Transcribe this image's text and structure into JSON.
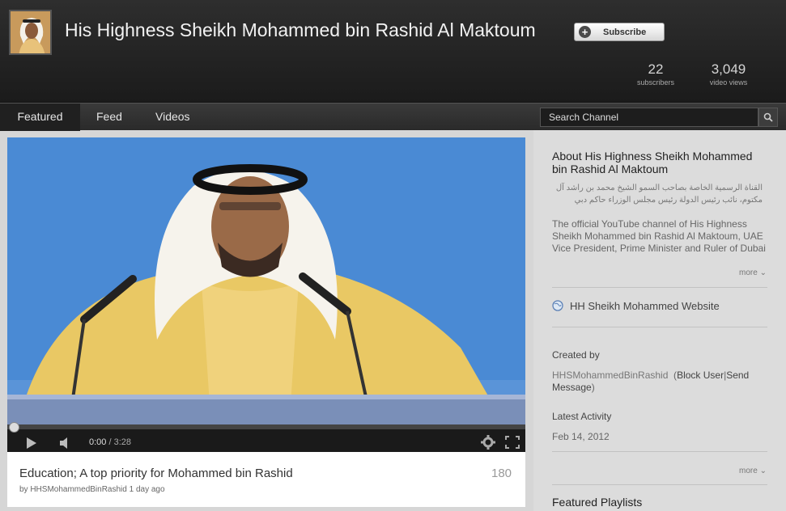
{
  "header": {
    "channel_title": "His Highness Sheikh Mohammed bin Rashid Al Maktoum",
    "subscribe_label": "Subscribe",
    "stats": [
      {
        "value": "22",
        "label": "subscribers"
      },
      {
        "value": "3,049",
        "label": "video views"
      }
    ]
  },
  "nav": {
    "tabs": [
      {
        "label": "Featured",
        "active": true
      },
      {
        "label": "Feed",
        "active": false
      },
      {
        "label": "Videos",
        "active": false
      }
    ],
    "search_placeholder": "Search Channel"
  },
  "video": {
    "time_current": "0:00",
    "time_total": "/ 3:28",
    "title": "Education; A top priority for Mohammed bin Rashid",
    "views": "180",
    "byline": "by HHSMohammedBinRashid 1 day ago"
  },
  "sidebar": {
    "about_title": "About His Highness Sheikh Mohammed bin Rashid Al Maktoum",
    "about_arabic": "القناة الرسمية الخاصة بصاحب السمو الشيخ محمد بن راشد آل مكتوم، نائب رئيس الدولة رئيس مجلس الوزراء حاكم دبي",
    "about_english": "The official YouTube channel of His Highness Sheikh Mohammed bin Rashid Al Maktoum, UAE Vice President, Prime Minister and Ruler of Dubai",
    "more_label": "more",
    "website_label": "HH Sheikh Mohammed Website",
    "created_by_label": "Created by",
    "creator": "HHSMohammedBinRashid",
    "block_user": "Block User",
    "send_message": "Send Message",
    "latest_activity_label": "Latest Activity",
    "latest_activity_date": "Feb 14, 2012",
    "featured_playlists_label": "Featured Playlists"
  }
}
